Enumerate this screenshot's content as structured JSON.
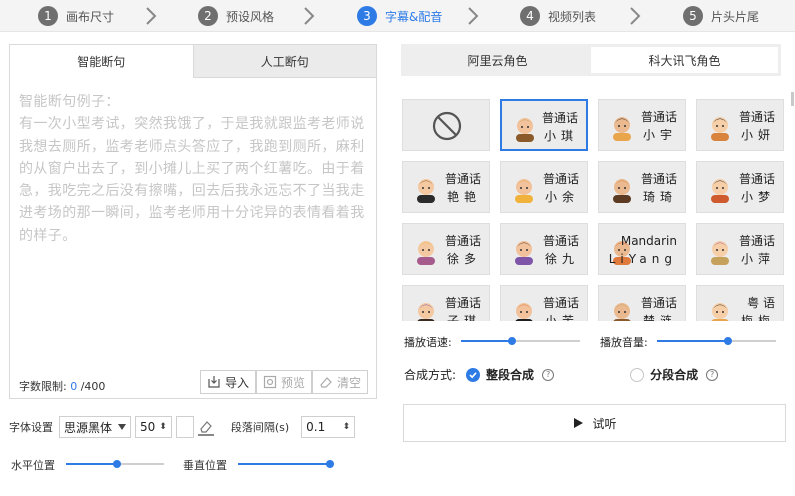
{
  "steps": [
    {
      "num": "1",
      "label": "画布尺寸"
    },
    {
      "num": "2",
      "label": "预设风格"
    },
    {
      "num": "3",
      "label": "字幕&配音"
    },
    {
      "num": "4",
      "label": "视频列表"
    },
    {
      "num": "5",
      "label": "片头片尾"
    }
  ],
  "active_step": 3,
  "colors": {
    "accent": "#2e7be6",
    "step_inactive": "#6f6f6f"
  },
  "left": {
    "tabs": [
      "智能断句",
      "人工断句"
    ],
    "selected_tab": 0,
    "text": "智能断句例子：\n有一次小型考试，突然我饿了，于是我就跟监考老师说我想去厕所，监考老师点头答应了，我跑到厕所，麻利的从窗户出去了，到小摊儿上买了两个红薯吃。由于着急，我吃完之后没有擦嘴，回去后我永远忘不了当我走进考场的那一瞬间，监考老师用十分诧异的表情看着我的样子。",
    "limit_label": "字数限制:",
    "limit_count": "0",
    "limit_max": "/400",
    "import_label": "导入",
    "preview_label": "预览",
    "clear_label": "清空"
  },
  "font": {
    "label": "字体设置",
    "family": "思源黑体",
    "size": "50",
    "para_label": "段落间隔(s)",
    "para_value": "0.1",
    "h_pos_label": "水平位置",
    "v_pos_label": "垂直位置",
    "h_pos": 0.52,
    "v_pos": 1.0
  },
  "right": {
    "provider_tabs": [
      "阿里云角色",
      "科大讯飞角色"
    ],
    "selected_provider": 1,
    "voices": [
      {
        "line1": "",
        "line2": "",
        "icon": "none-icon"
      },
      {
        "line1": "普通话",
        "line2": "小琪",
        "icon": "avatar-xiaoqi-icon",
        "selected": true
      },
      {
        "line1": "普通话",
        "line2": "小宇",
        "icon": "avatar-xiaoyu-icon"
      },
      {
        "line1": "普通话",
        "line2": "小妍",
        "icon": "avatar-xiaoyan-icon"
      },
      {
        "line1": "普通话",
        "line2": "艳艳",
        "icon": "avatar-yanyan-icon"
      },
      {
        "line1": "普通话",
        "line2": "小余",
        "icon": "avatar-xiaoyu2-icon"
      },
      {
        "line1": "普通话",
        "line2": "琦琦",
        "icon": "avatar-qiqi-icon"
      },
      {
        "line1": "普通话",
        "line2": "小梦",
        "icon": "avatar-xiaomeng-icon"
      },
      {
        "line1": "普通话",
        "line2": "徐多",
        "icon": "avatar-xuduo-icon"
      },
      {
        "line1": "普通话",
        "line2": "徐九",
        "icon": "avatar-xujiu-icon"
      },
      {
        "line1": "Mandarin",
        "line2": "LiYang",
        "icon": "avatar-liyang-icon"
      },
      {
        "line1": "普通话",
        "line2": "小萍",
        "icon": "avatar-xiaoping-icon"
      },
      {
        "line1": "普通话",
        "line2": "子琪",
        "icon": "avatar-ziqi-icon"
      },
      {
        "line1": "普通话",
        "line2": "小苦",
        "icon": "avatar-xiaoku-icon"
      },
      {
        "line1": "普通话",
        "line2": "楚涟",
        "icon": "avatar-chulian-icon"
      },
      {
        "line1": "粤 语",
        "line2": "梅梅",
        "icon": "avatar-meimei-icon"
      }
    ],
    "speed_label": "播放语速:",
    "volume_label": "播放音量:",
    "speed": 0.42,
    "volume": 0.6,
    "synth_label": "合成方式:",
    "synth_whole": "整段合成",
    "synth_split": "分段合成",
    "listen_label": "试听"
  }
}
